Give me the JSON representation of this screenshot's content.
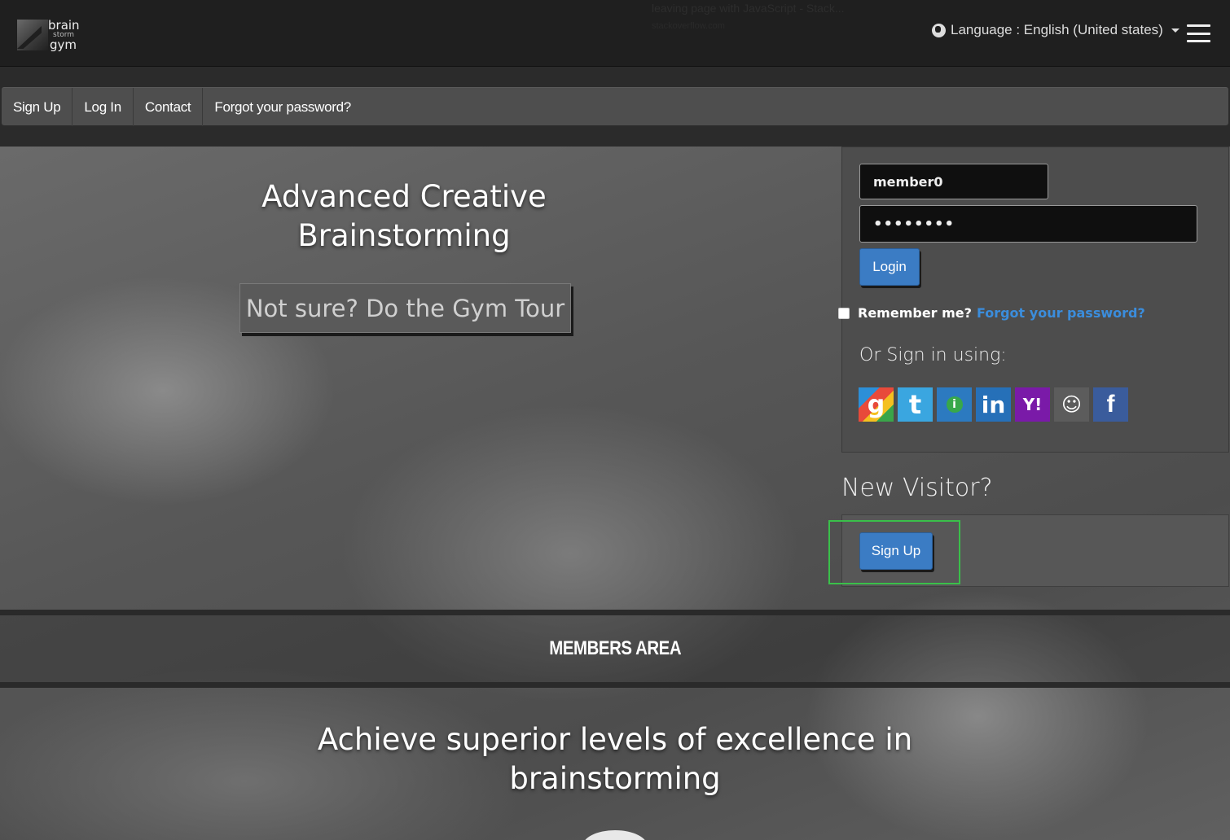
{
  "header": {
    "logo": {
      "line1": "brain",
      "line2": "storm",
      "line3": "gym"
    },
    "faded_notice": "leaving page with JavaScript - Stack...",
    "faded_notice_sub": "stackoverflow.com",
    "language_label": "Language : English (United states)"
  },
  "nav": {
    "items": [
      {
        "label": "Sign Up"
      },
      {
        "label": "Log In"
      },
      {
        "label": "Contact"
      },
      {
        "label": "Forgot your password?"
      }
    ]
  },
  "hero": {
    "title": "Advanced Creative Brainstorming",
    "tour_button": "Not sure? Do the Gym Tour"
  },
  "login": {
    "username_value": "member0",
    "password_value": "••••••••",
    "login_button": "Login",
    "remember_label": "Remember me?",
    "forgot_link": "Forgot your password?",
    "or_signin": "Or Sign in using:",
    "providers": [
      {
        "name": "Google",
        "glyph": "g",
        "icon": "google-icon"
      },
      {
        "name": "Twitter",
        "glyph": "t",
        "icon": "twitter-icon"
      },
      {
        "name": "OpenID",
        "glyph": "i",
        "icon": "openid-icon"
      },
      {
        "name": "LinkedIn",
        "glyph": "in",
        "icon": "linkedin-icon"
      },
      {
        "name": "Yahoo",
        "glyph": "Y!",
        "icon": "yahoo-icon"
      },
      {
        "name": "GitHub",
        "glyph": "☺",
        "icon": "github-icon"
      },
      {
        "name": "Facebook",
        "glyph": "f",
        "icon": "facebook-icon"
      }
    ]
  },
  "visitor": {
    "title": "New Visitor?",
    "signup_button": "Sign Up"
  },
  "members": {
    "title": "MEMBERS AREA",
    "tagline": "Achieve superior levels of excellence in brainstorming"
  },
  "colors": {
    "accent_blue": "#3b7cc4",
    "link_blue": "#3b8ddc",
    "focus_green": "#3ac04a"
  }
}
